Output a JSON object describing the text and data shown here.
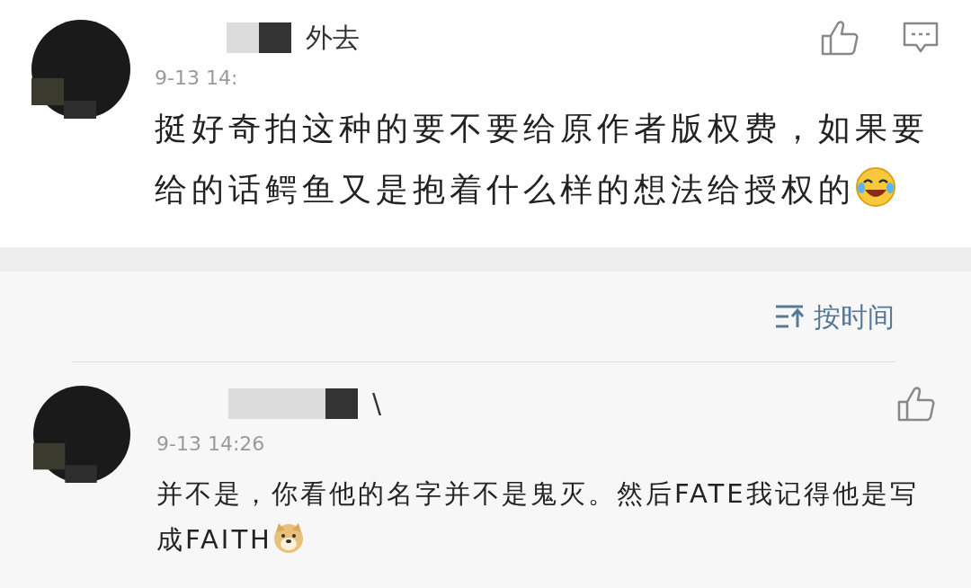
{
  "post_comment": {
    "author": "外去",
    "time": "9-13 14:",
    "text": "挺好奇拍这种的要不要给原作者版权费，如果要给的话鳄鱼又是抱着什么样的想法给授权的",
    "emoji": {
      "kind": "laugh"
    },
    "actions": [
      {
        "kind": "like"
      },
      {
        "kind": "comment"
      }
    ]
  },
  "sort": {
    "label": "按时间"
  },
  "replies": [
    {
      "author": "\\",
      "time": "9-13 14:26",
      "text": "并不是，你看他的名字并不是鬼灭。然后FATE我记得他是写成FAITH",
      "emoji": {
        "kind": "dog"
      },
      "actions": [
        {
          "kind": "like"
        }
      ]
    }
  ]
}
